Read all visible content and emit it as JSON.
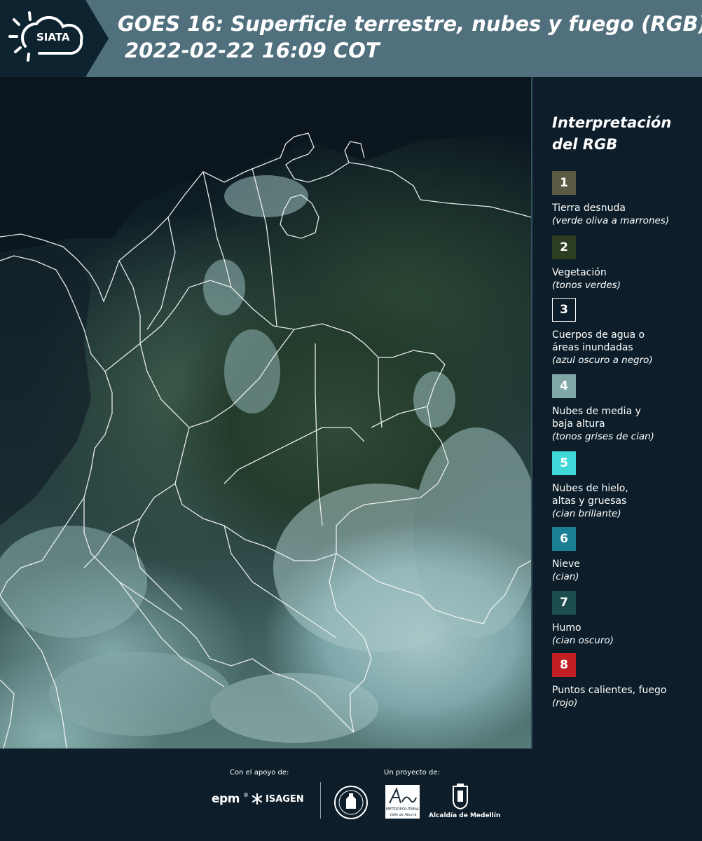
{
  "header": {
    "logo_text": "SIATA",
    "title_line1": "GOES 16: Superficie terrestre, nubes y fuego (RGB)",
    "title_line2": "2022-02-22 16:09 COT"
  },
  "legend": {
    "title_line1": "Interpretación",
    "title_line2": "del RGB",
    "items": [
      {
        "number": "1",
        "color": "#5b5b43",
        "label": "Tierra desnuda",
        "desc": "(verde oliva a marrones)"
      },
      {
        "number": "2",
        "color": "#2e3e22",
        "label": "Vegetación",
        "desc": "(tonos verdes)"
      },
      {
        "number": "3",
        "color": "#0d1e2a",
        "label": "Cuerpos de agua o áreas inundadas",
        "desc": "(azul oscuro a negro)"
      },
      {
        "number": "4",
        "color": "#7fa7a6",
        "label": "Nubes de media y baja altura",
        "desc": "(tonos grises de cian)"
      },
      {
        "number": "5",
        "color": "#3ed9d8",
        "label": "Nubes de hielo, altas y gruesas",
        "desc": "(cian brillante)"
      },
      {
        "number": "6",
        "color": "#1b7f96",
        "label": "Nieve",
        "desc": "(cian)"
      },
      {
        "number": "7",
        "color": "#1e4d4e",
        "label": "Humo",
        "desc": "(cian oscuro)"
      },
      {
        "number": "8",
        "color": "#c01f23",
        "label": "Puntos calientes, fuego",
        "desc": "(rojo)"
      }
    ]
  },
  "footer": {
    "support_label": "Con el apoyo de:",
    "project_label": "Un proyecto de:",
    "sponsor_epm": "epm",
    "sponsor_isagen": "ISAGEN",
    "sponsor_area_line1": "METROPOLITANA",
    "sponsor_area_line2": "Valle de Aburrá",
    "sponsor_alcaldia": "Alcaldía de Medellín"
  }
}
